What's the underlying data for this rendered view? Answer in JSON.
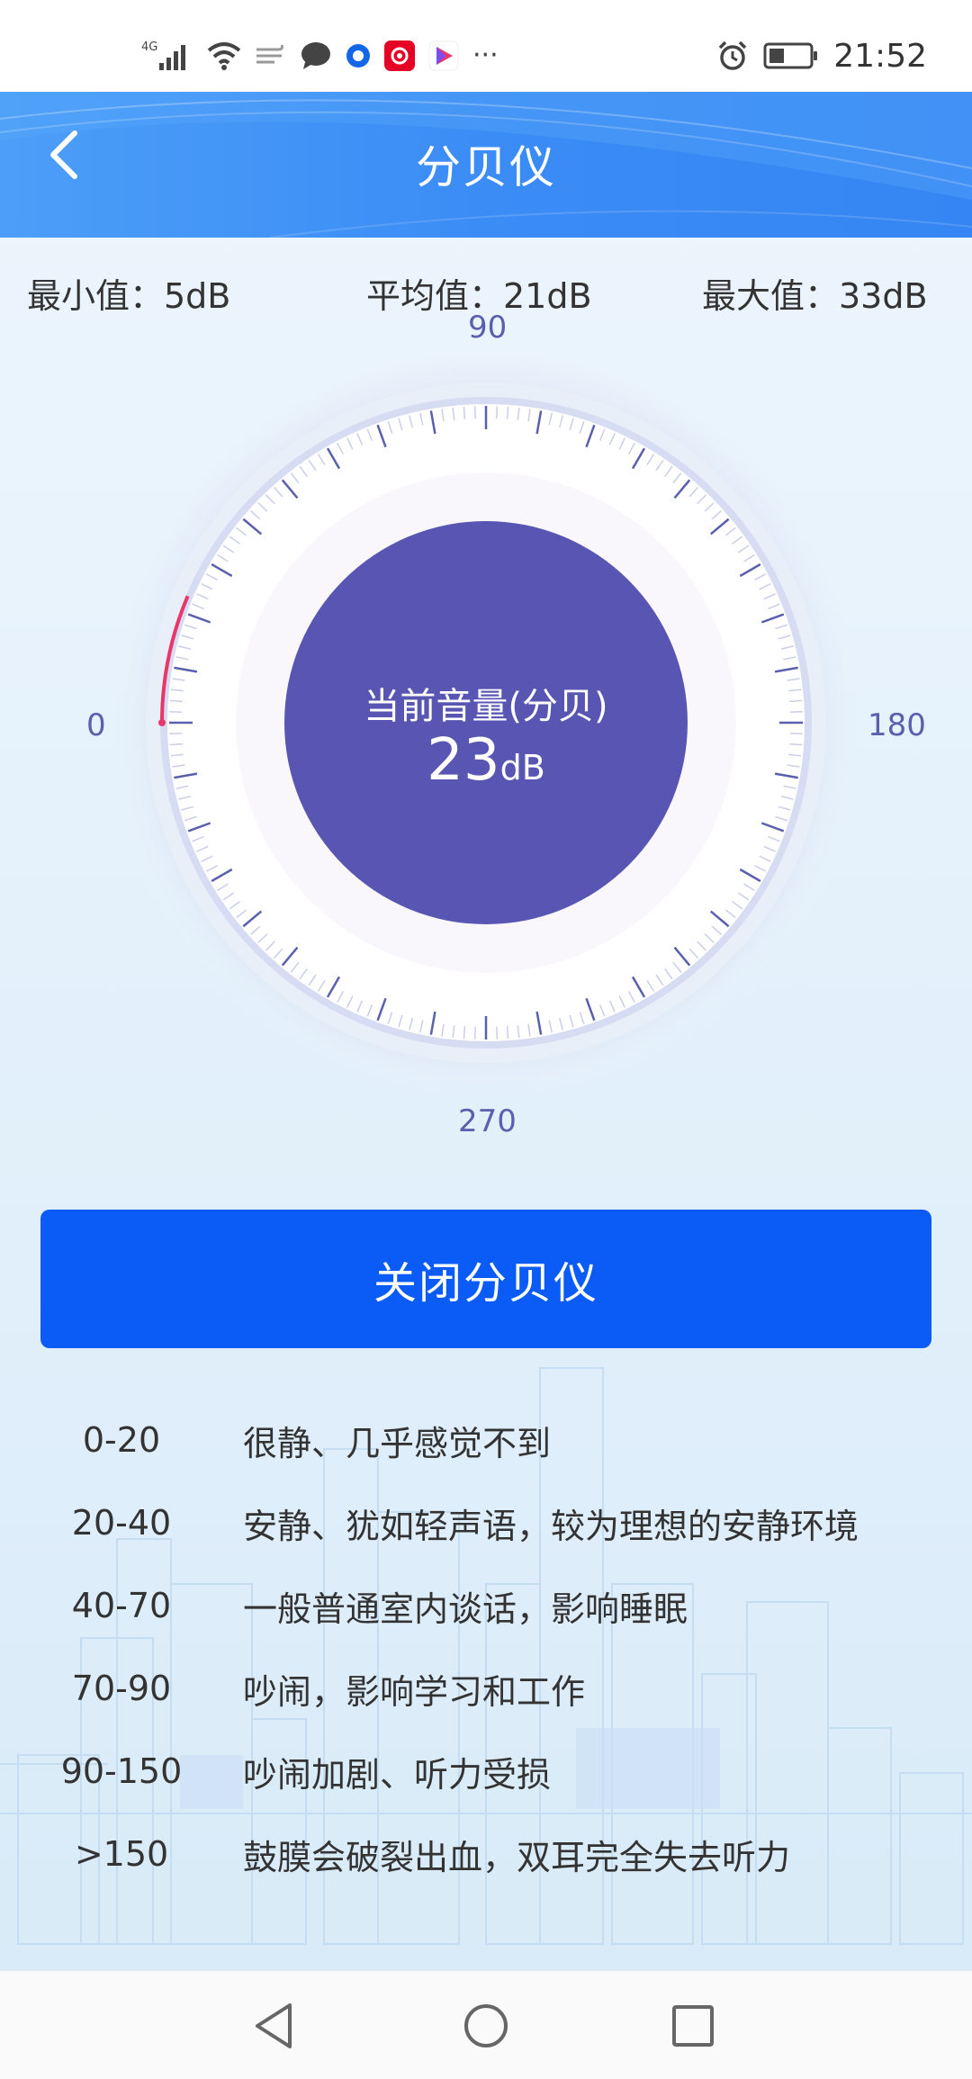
{
  "status_bar": {
    "network": "4G",
    "time": "21:52",
    "more": "···",
    "icons": [
      "signal-icon",
      "wifi-icon",
      "data-saver-icon",
      "message-icon",
      "app-blue-icon",
      "netease-music-icon",
      "video-app-icon",
      "more-icon",
      "alarm-icon",
      "battery-icon"
    ]
  },
  "header": {
    "title": "分贝仪",
    "back_icon": "chevron-left-icon"
  },
  "stats": {
    "min": "最小值：5dB",
    "avg": "平均值：21dB",
    "max": "最大值：33dB"
  },
  "gauge": {
    "label_top": "90",
    "label_left": "0",
    "label_right": "180",
    "label_bottom": "270",
    "center_title": "当前音量(分贝)",
    "current_value": "23",
    "current_unit": "dB",
    "level": 23,
    "scale_max": 360,
    "colors": {
      "center": "#5856b2",
      "indicator": "#e8386a",
      "ticks": "#5a5fae",
      "ring": "#d6dcf2"
    }
  },
  "controls": {
    "close_label": "关闭分贝仪",
    "button_color": "#0b5cf7"
  },
  "legend": [
    {
      "range": "0-20",
      "desc": "很静、几乎感觉不到"
    },
    {
      "range": "20-40",
      "desc": "安静、犹如轻声语，较为理想的安静环境"
    },
    {
      "range": "40-70",
      "desc": "一般普通室内谈话，影响睡眠"
    },
    {
      "range": "70-90",
      "desc": "吵闹，影响学习和工作"
    },
    {
      "range": "90-150",
      "desc": "吵闹加剧、听力受损"
    },
    {
      "range": ">150",
      "desc": "鼓膜会破裂出血，双耳完全失去听力"
    }
  ],
  "nav": {
    "icons": [
      "back-triangle-icon",
      "home-circle-icon",
      "recents-square-icon"
    ]
  }
}
